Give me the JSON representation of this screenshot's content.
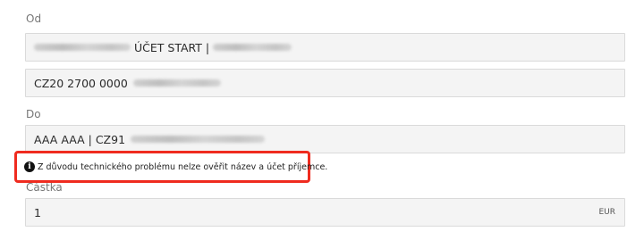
{
  "from": {
    "label": "Od",
    "account_name_visible": "ÚČET START |",
    "iban_prefix": "CZ20 2700 0000"
  },
  "to": {
    "label": "Do",
    "recipient_visible": "AAA AAA | CZ91"
  },
  "warning": {
    "icon": "info-icon",
    "text": "Z důvodu technického problému nelze ověřit název a účet příjemce."
  },
  "amount": {
    "label": "Částka",
    "value": "1",
    "currency": "EUR"
  },
  "colors": {
    "highlight_border": "#ef2b1f",
    "field_background": "#f4f4f4"
  }
}
